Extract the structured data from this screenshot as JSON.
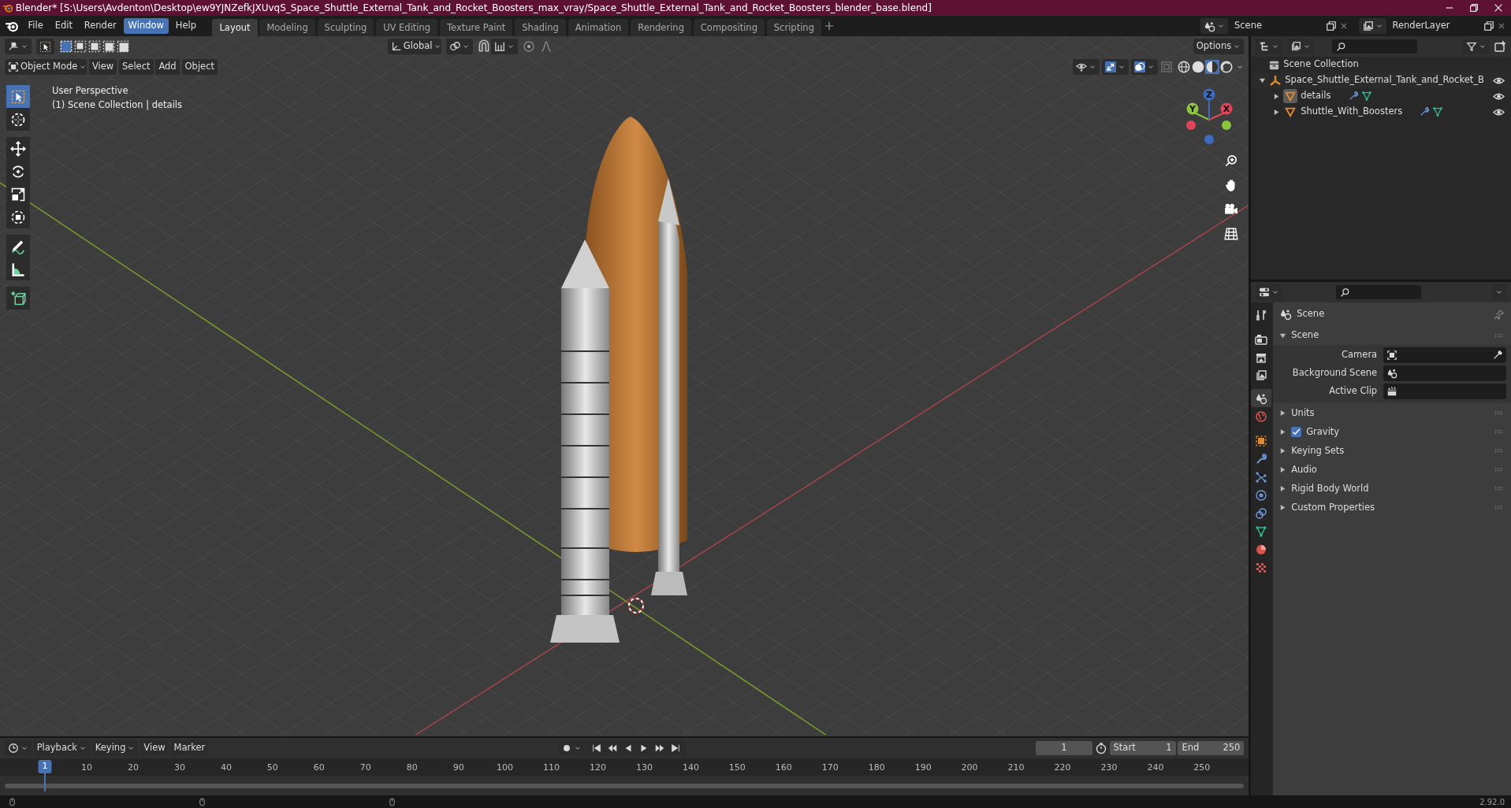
{
  "title_bar": {
    "title": "Blender* [S:\\Users\\Avdenton\\Desktop\\ew9YJNZefkJXUvqS_Space_Shuttle_External_Tank_and_Rocket_Boosters_max_vray/Space_Shuttle_External_Tank_and_Rocket_Boosters_blender_base.blend]"
  },
  "menu": [
    {
      "label": "File",
      "selected": false
    },
    {
      "label": "Edit",
      "selected": false
    },
    {
      "label": "Render",
      "selected": false
    },
    {
      "label": "Window",
      "selected": true
    },
    {
      "label": "Help",
      "selected": false
    }
  ],
  "workspace_tabs": [
    {
      "label": "Layout",
      "selected": true
    },
    {
      "label": "Modeling",
      "selected": false
    },
    {
      "label": "Sculpting",
      "selected": false
    },
    {
      "label": "UV Editing",
      "selected": false
    },
    {
      "label": "Texture Paint",
      "selected": false
    },
    {
      "label": "Shading",
      "selected": false
    },
    {
      "label": "Animation",
      "selected": false
    },
    {
      "label": "Rendering",
      "selected": false
    },
    {
      "label": "Compositing",
      "selected": false
    },
    {
      "label": "Scripting",
      "selected": false
    }
  ],
  "scene_field": {
    "value": "Scene"
  },
  "view_layer_field": {
    "value": "RenderLayer"
  },
  "viewport": {
    "orientation": "Global",
    "options": "Options",
    "mode": "Object Mode",
    "menus": [
      "View",
      "Select",
      "Add",
      "Object"
    ],
    "overlay_text": [
      "User Perspective",
      "(1) Scene Collection | details"
    ],
    "tools": [
      {
        "kind": "select",
        "selected": true
      },
      {
        "kind": "cursor",
        "selected": false
      },
      {
        "kind": "move",
        "selected": false
      },
      {
        "kind": "rotate",
        "selected": false
      },
      {
        "kind": "scale",
        "selected": false
      },
      {
        "kind": "transform",
        "selected": false
      },
      {
        "kind": "annotate",
        "selected": false
      },
      {
        "kind": "measure",
        "selected": false
      },
      {
        "kind": "add_cube",
        "selected": false
      }
    ],
    "gizmo_axes": [
      "Z",
      "Y",
      "X"
    ]
  },
  "outliner": {
    "root": "Scene Collection",
    "items": [
      {
        "label": "Space_Shuttle_External_Tank_and_Rocket_B",
        "expanded": true,
        "children": [
          {
            "label": "details",
            "expanded": false,
            "selected": true
          },
          {
            "label": "Shuttle_With_Boosters",
            "expanded": false,
            "selected": false
          }
        ]
      }
    ]
  },
  "properties": {
    "context": "Scene",
    "tabs": [
      {
        "kind": "tool",
        "selected": false
      },
      {
        "kind": "render",
        "selected": false
      },
      {
        "kind": "output",
        "selected": false
      },
      {
        "kind": "view_layer",
        "selected": false
      },
      {
        "kind": "scene",
        "selected": true
      },
      {
        "kind": "world",
        "selected": false
      },
      {
        "kind": "object",
        "selected": false
      },
      {
        "kind": "modifier",
        "selected": false
      },
      {
        "kind": "particles",
        "selected": false
      },
      {
        "kind": "physics",
        "selected": false
      },
      {
        "kind": "constraints",
        "selected": false
      },
      {
        "kind": "data",
        "selected": false
      },
      {
        "kind": "material",
        "selected": false
      },
      {
        "kind": "texture",
        "selected": false
      }
    ],
    "panels": [
      {
        "kind": "plain",
        "label": "Scene",
        "expanded": true,
        "fields": [
          {
            "label": "Camera",
            "kind": "camera"
          },
          {
            "label": "Background Scene",
            "kind": "scene"
          },
          {
            "label": "Active Clip",
            "kind": "clip"
          }
        ]
      },
      {
        "kind": "plain",
        "label": "Units",
        "expanded": false
      },
      {
        "kind": "checkbox",
        "label": "Gravity",
        "expanded": false,
        "checked": true
      },
      {
        "kind": "plain",
        "label": "Keying Sets",
        "expanded": false
      },
      {
        "kind": "plain",
        "label": "Audio",
        "expanded": false
      },
      {
        "kind": "plain",
        "label": "Rigid Body World",
        "expanded": false
      },
      {
        "kind": "plain",
        "label": "Custom Properties",
        "expanded": false
      }
    ]
  },
  "timeline": {
    "menus": [
      "Playback",
      "Keying",
      "View",
      "Marker"
    ],
    "current_frame": "1",
    "start_label": "Start",
    "start": "1",
    "end_label": "End",
    "end": "250",
    "playhead": "1",
    "ruler": [
      "10",
      "20",
      "30",
      "40",
      "50",
      "60",
      "70",
      "80",
      "90",
      "100",
      "110",
      "120",
      "130",
      "140",
      "150",
      "160",
      "170",
      "180",
      "190",
      "200",
      "210",
      "220",
      "230",
      "240",
      "250"
    ]
  },
  "status_bar": {
    "version": "2.92.0"
  }
}
